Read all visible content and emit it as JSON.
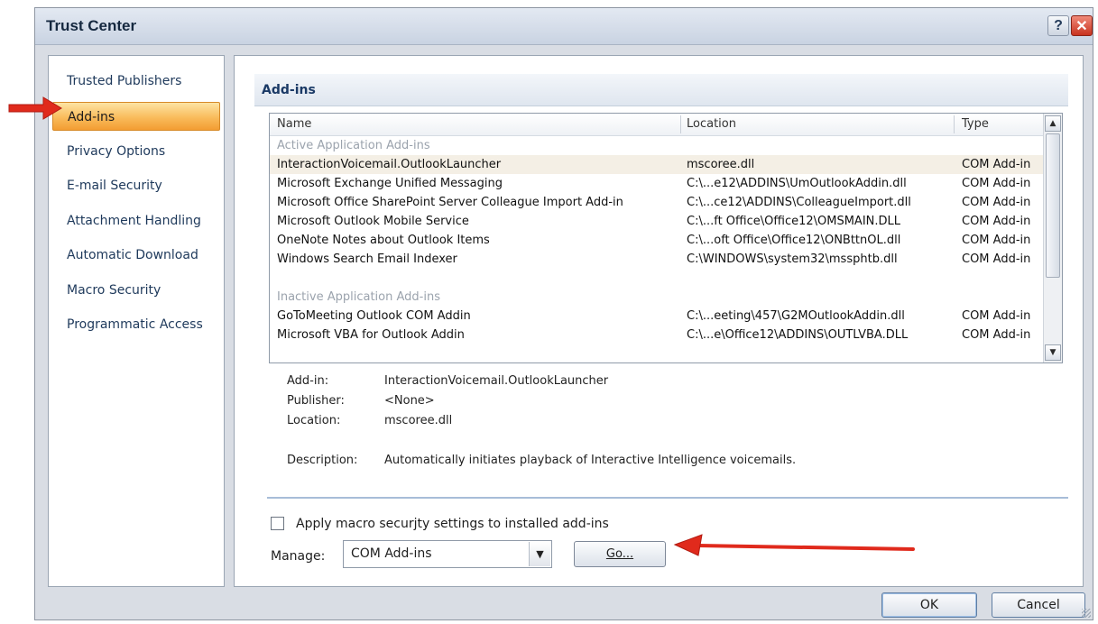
{
  "dialog": {
    "title": "Trust Center",
    "help_glyph": "?",
    "close_glyph": "✕"
  },
  "nav": {
    "items": [
      {
        "label": "Trusted Publishers"
      },
      {
        "label": "Add-ins"
      },
      {
        "label": "Privacy Options"
      },
      {
        "label": "E-mail Security"
      },
      {
        "label": "Attachment Handling"
      },
      {
        "label": "Automatic Download"
      },
      {
        "label": "Macro Security"
      },
      {
        "label": "Programmatic Access"
      }
    ],
    "selected": "Add-ins"
  },
  "content": {
    "section_title": "Add-ins",
    "grid": {
      "headers": {
        "name": "Name",
        "location": "Location",
        "type": "Type"
      },
      "active_group": "Active Application Add-ins",
      "active_rows": [
        {
          "name": "InteractionVoicemail.OutlookLauncher",
          "location": "mscoree.dll",
          "type": "COM Add-in"
        },
        {
          "name": "Microsoft Exchange Unified Messaging",
          "location": "C:\\...e12\\ADDINS\\UmOutlookAddin.dll",
          "type": "COM Add-in"
        },
        {
          "name": "Microsoft Office SharePoint Server Colleague Import Add-in",
          "location": "C:\\...ce12\\ADDINS\\ColleagueImport.dll",
          "type": "COM Add-in"
        },
        {
          "name": "Microsoft Outlook Mobile Service",
          "location": "C:\\...ft Office\\Office12\\OMSMAIN.DLL",
          "type": "COM Add-in"
        },
        {
          "name": "OneNote Notes about Outlook Items",
          "location": "C:\\...oft Office\\Office12\\ONBttnOL.dll",
          "type": "COM Add-in"
        },
        {
          "name": "Windows Search Email Indexer",
          "location": "C:\\WINDOWS\\system32\\mssphtb.dll",
          "type": "COM Add-in"
        }
      ],
      "inactive_group": "Inactive Application Add-ins",
      "inactive_rows": [
        {
          "name": "GoToMeeting Outlook COM Addin",
          "location": "C:\\...eeting\\457\\G2MOutlookAddin.dll",
          "type": "COM Add-in"
        },
        {
          "name": "Microsoft VBA for Outlook Addin",
          "location": "C:\\...e\\Office12\\ADDINS\\OUTLVBA.DLL",
          "type": "COM Add-in"
        }
      ],
      "scroll_up_glyph": "▲",
      "scroll_down_glyph": "▼"
    },
    "details": {
      "addin_label": "Add-in:",
      "addin_value": "InteractionVoicemail.OutlookLauncher",
      "publisher_label": "Publisher:",
      "publisher_value": "<None>",
      "location_label": "Location:",
      "location_value": "mscoree.dll",
      "description_label": "Description:",
      "description_value": "Automatically initiates playback of Interactive Intelligence voicemails."
    },
    "macro_checkbox_label": "Apply macro securjty settings to installed add-ins",
    "macro_checkbox_checked": false,
    "manage_label": "Manage:",
    "manage_value": "COM Add-ins",
    "manage_arrow_glyph": "▼",
    "go_label": "Go..."
  },
  "footer": {
    "ok_label": "OK",
    "cancel_label": "Cancel"
  },
  "annotation": {
    "arrow_color": "#e02a1c"
  },
  "colors": {
    "selected_nav": "#f9bb5b",
    "section_header_text": "#1b3a66",
    "group_text": "#9ba3ad"
  }
}
